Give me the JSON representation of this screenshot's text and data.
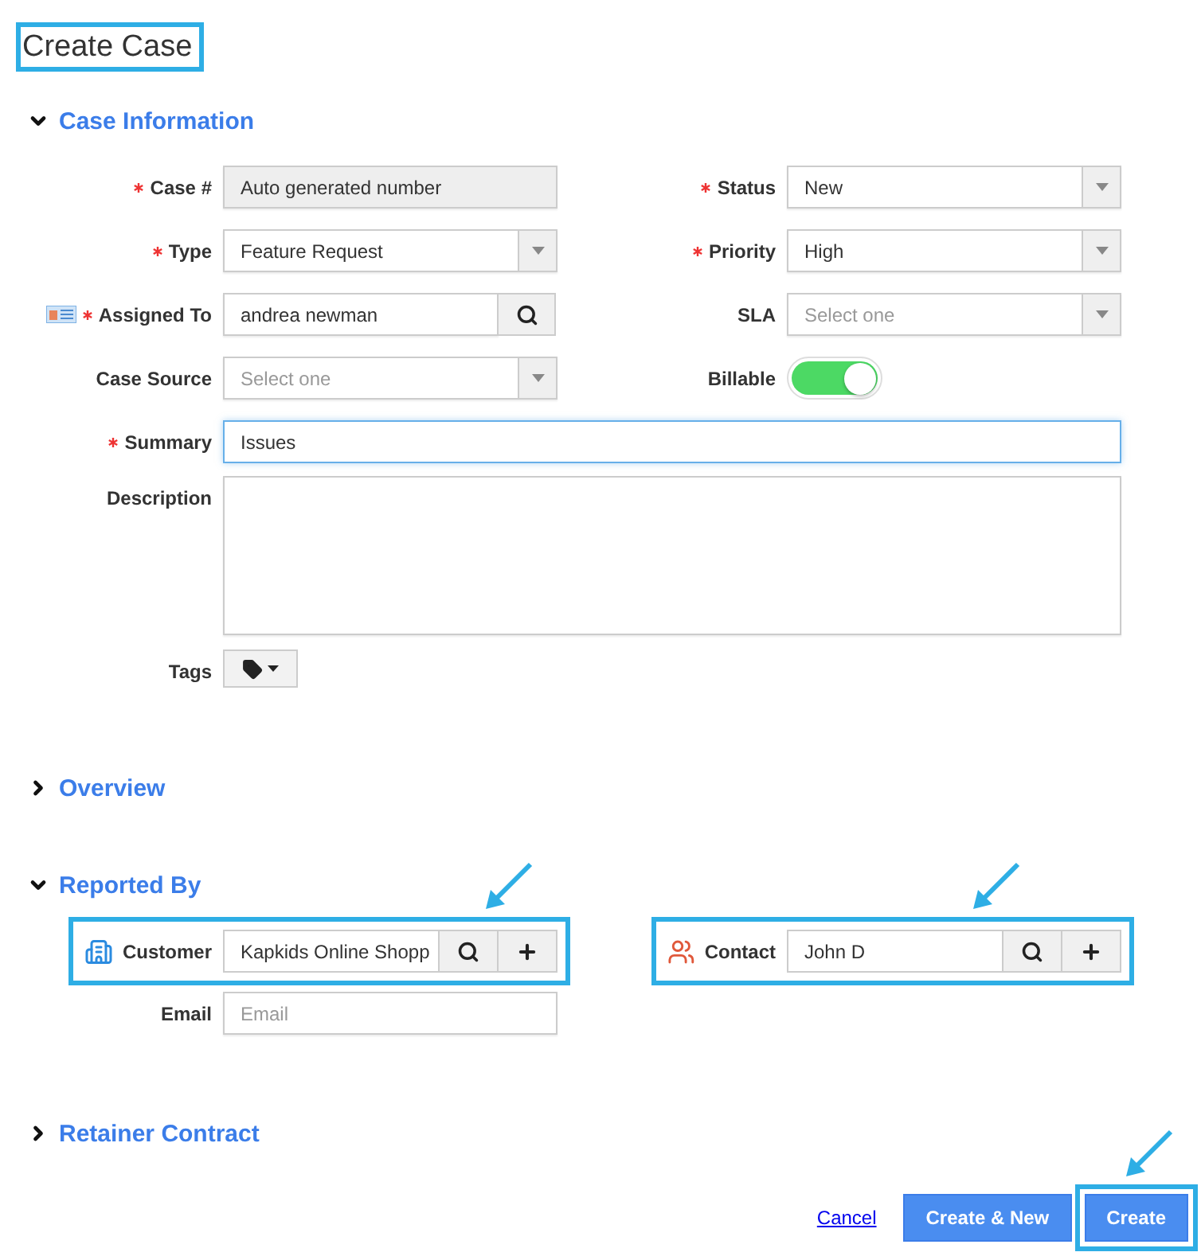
{
  "title": {
    "text": "Create Case",
    "highlighted": true
  },
  "case_information": {
    "title": "Case Information",
    "expanded": true,
    "fields": [
      {
        "kind": "readonly",
        "label": "Case #",
        "required": true,
        "value": "Auto generated number"
      },
      {
        "kind": "select",
        "label": "Status",
        "required": true,
        "value": "New"
      },
      {
        "kind": "select",
        "label": "Type",
        "required": true,
        "value": "Feature Request"
      },
      {
        "kind": "select",
        "label": "Priority",
        "required": true,
        "value": "High"
      },
      {
        "kind": "lookup",
        "label": "Assigned To",
        "required": true,
        "value": "andrea newman"
      },
      {
        "kind": "select",
        "label": "SLA",
        "required": false,
        "placeholder": "Select one"
      },
      {
        "kind": "select",
        "label": "Case Source",
        "required": false,
        "placeholder": "Select one"
      },
      {
        "kind": "toggle",
        "label": "Billable",
        "required": false,
        "on": true
      },
      {
        "kind": "text",
        "label": "Summary",
        "required": true,
        "value": "Issues",
        "focused": true
      },
      {
        "kind": "textarea",
        "label": "Description",
        "required": false
      },
      {
        "kind": "tags",
        "label": "Tags",
        "required": false
      }
    ]
  },
  "overview": {
    "title": "Overview",
    "expanded": false
  },
  "reported_by": {
    "title": "Reported By",
    "expanded": true,
    "customer": {
      "label": "Customer",
      "value": "Kapkids Online Shopp",
      "highlighted": true
    },
    "contact": {
      "label": "Contact",
      "value": "John D",
      "highlighted": true
    },
    "email": {
      "label": "Email",
      "placeholder": "Email"
    }
  },
  "retainer_contract": {
    "title": "Retainer Contract",
    "expanded": false
  },
  "actions": {
    "cancel": "Cancel",
    "create_new": "Create & New",
    "create": {
      "label": "Create",
      "highlighted": true
    }
  }
}
